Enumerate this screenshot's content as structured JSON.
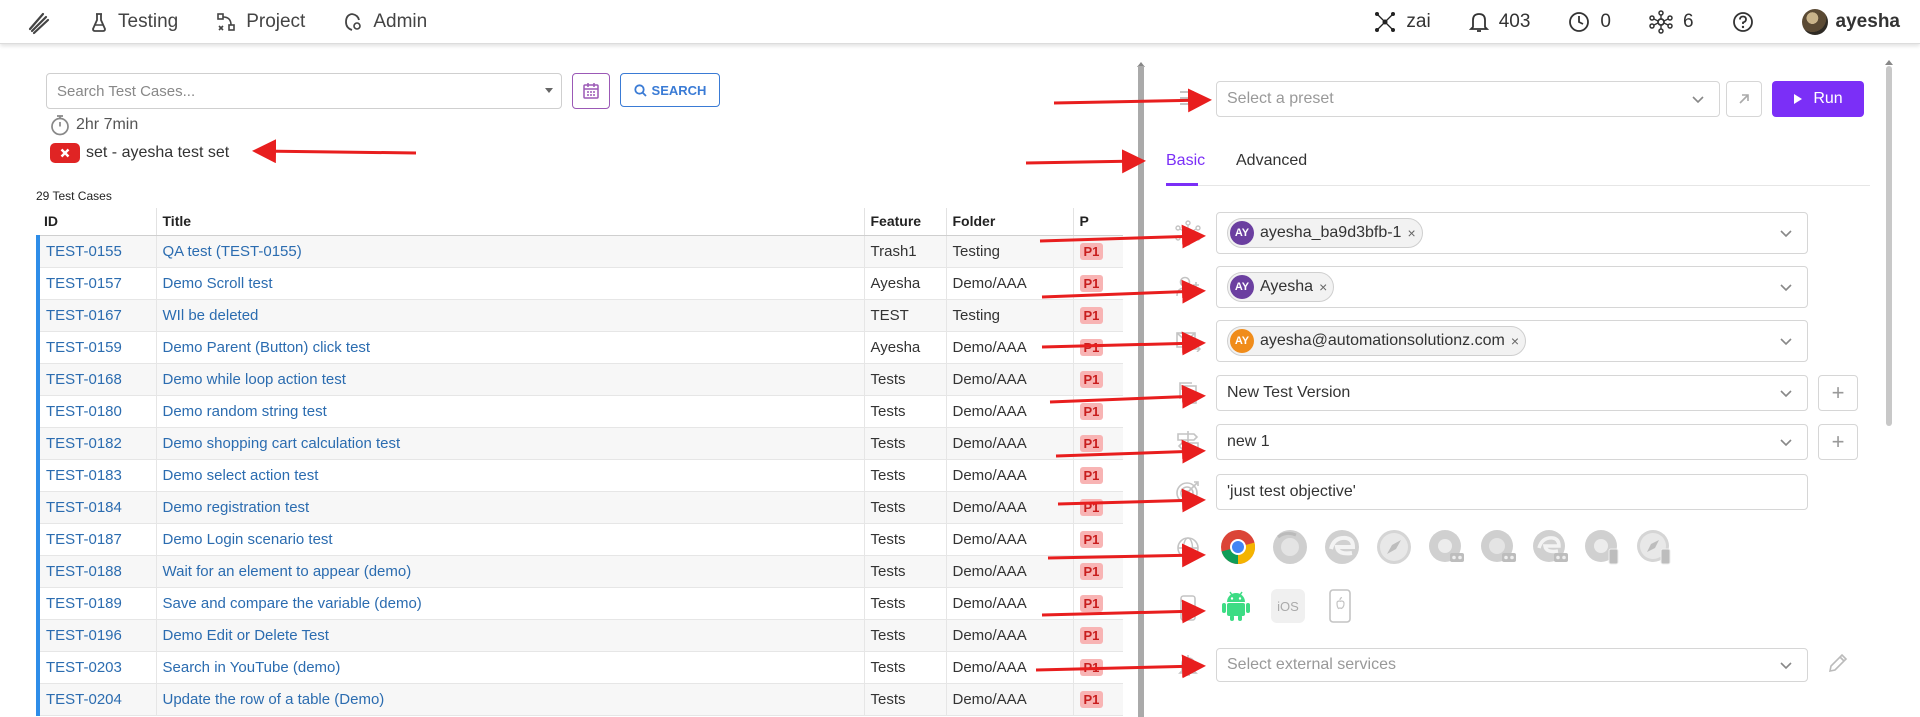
{
  "nav": {
    "items": [
      {
        "label": "Testing",
        "icon": "flask-icon"
      },
      {
        "label": "Project",
        "icon": "flow-icon"
      },
      {
        "label": "Admin",
        "icon": "admin-settings-icon"
      }
    ],
    "right": {
      "ai_label": "zai",
      "notifications": "403",
      "clock_count": "0",
      "network_count": "6",
      "username": "ayesha"
    }
  },
  "left": {
    "search_placeholder": "Search Test Cases...",
    "search_button": "SEARCH",
    "duration": "2hr 7min",
    "set_label": "set - ayesha test set",
    "case_count": "29 Test Cases",
    "columns": [
      "ID",
      "Title",
      "Feature",
      "Folder",
      "P"
    ],
    "rows": [
      {
        "id": "TEST-0155",
        "title": "QA test (TEST-0155)",
        "feature": "Trash1",
        "folder": "Testing",
        "priority": "P1"
      },
      {
        "id": "TEST-0157",
        "title": "Demo Scroll test",
        "feature": "Ayesha",
        "folder": "Demo/AAA",
        "priority": "P1"
      },
      {
        "id": "TEST-0167",
        "title": "WIl be deleted",
        "feature": "TEST",
        "folder": "Testing",
        "priority": "P1"
      },
      {
        "id": "TEST-0159",
        "title": "Demo Parent (Button) click test",
        "feature": "Ayesha",
        "folder": "Demo/AAA",
        "priority": "P1"
      },
      {
        "id": "TEST-0168",
        "title": "Demo while loop action test",
        "feature": "Tests",
        "folder": "Demo/AAA",
        "priority": "P1"
      },
      {
        "id": "TEST-0180",
        "title": "Demo random string test",
        "feature": "Tests",
        "folder": "Demo/AAA",
        "priority": "P1"
      },
      {
        "id": "TEST-0182",
        "title": "Demo shopping cart calculation test",
        "feature": "Tests",
        "folder": "Demo/AAA",
        "priority": "P1"
      },
      {
        "id": "TEST-0183",
        "title": "Demo select action test",
        "feature": "Tests",
        "folder": "Demo/AAA",
        "priority": "P1"
      },
      {
        "id": "TEST-0184",
        "title": "Demo registration test",
        "feature": "Tests",
        "folder": "Demo/AAA",
        "priority": "P1"
      },
      {
        "id": "TEST-0187",
        "title": "Demo Login scenario test",
        "feature": "Tests",
        "folder": "Demo/AAA",
        "priority": "P1"
      },
      {
        "id": "TEST-0188",
        "title": "Wait for an element to appear (demo)",
        "feature": "Tests",
        "folder": "Demo/AAA",
        "priority": "P1"
      },
      {
        "id": "TEST-0189",
        "title": "Save and compare the variable (demo)",
        "feature": "Tests",
        "folder": "Demo/AAA",
        "priority": "P1"
      },
      {
        "id": "TEST-0196",
        "title": "Demo Edit or Delete Test",
        "feature": "Tests",
        "folder": "Demo/AAA",
        "priority": "P1"
      },
      {
        "id": "TEST-0203",
        "title": "Search in YouTube (demo)",
        "feature": "Tests",
        "folder": "Demo/AAA",
        "priority": "P1"
      },
      {
        "id": "TEST-0204",
        "title": "Update the row of a table (Demo)",
        "feature": "Tests",
        "folder": "Demo/AAA",
        "priority": "P1"
      }
    ]
  },
  "right": {
    "preset_placeholder": "Select a preset",
    "run_label": "Run",
    "tabs": [
      "Basic",
      "Advanced"
    ],
    "agent_chip": {
      "initials": "AY",
      "label": "ayesha_ba9d3bfb-1"
    },
    "user_chip": {
      "initials": "AY",
      "label": "Ayesha"
    },
    "email_chip": {
      "initials": "AY",
      "label": "ayesha@automationsolutionz.com"
    },
    "version": "New Test Version",
    "build": "new 1",
    "objective": "'just test objective'",
    "ios_label": "iOS",
    "external_placeholder": "Select external services"
  },
  "colors": {
    "accent": "#7b2ff7",
    "link": "#2b6cb0",
    "row_marker": "#2e8de8",
    "priority_bg": "#f8b4b4",
    "priority_text": "#c81e1e",
    "danger": "#e02424",
    "avatar_purple": "#6b3fa0",
    "avatar_orange": "#f08c1a"
  }
}
